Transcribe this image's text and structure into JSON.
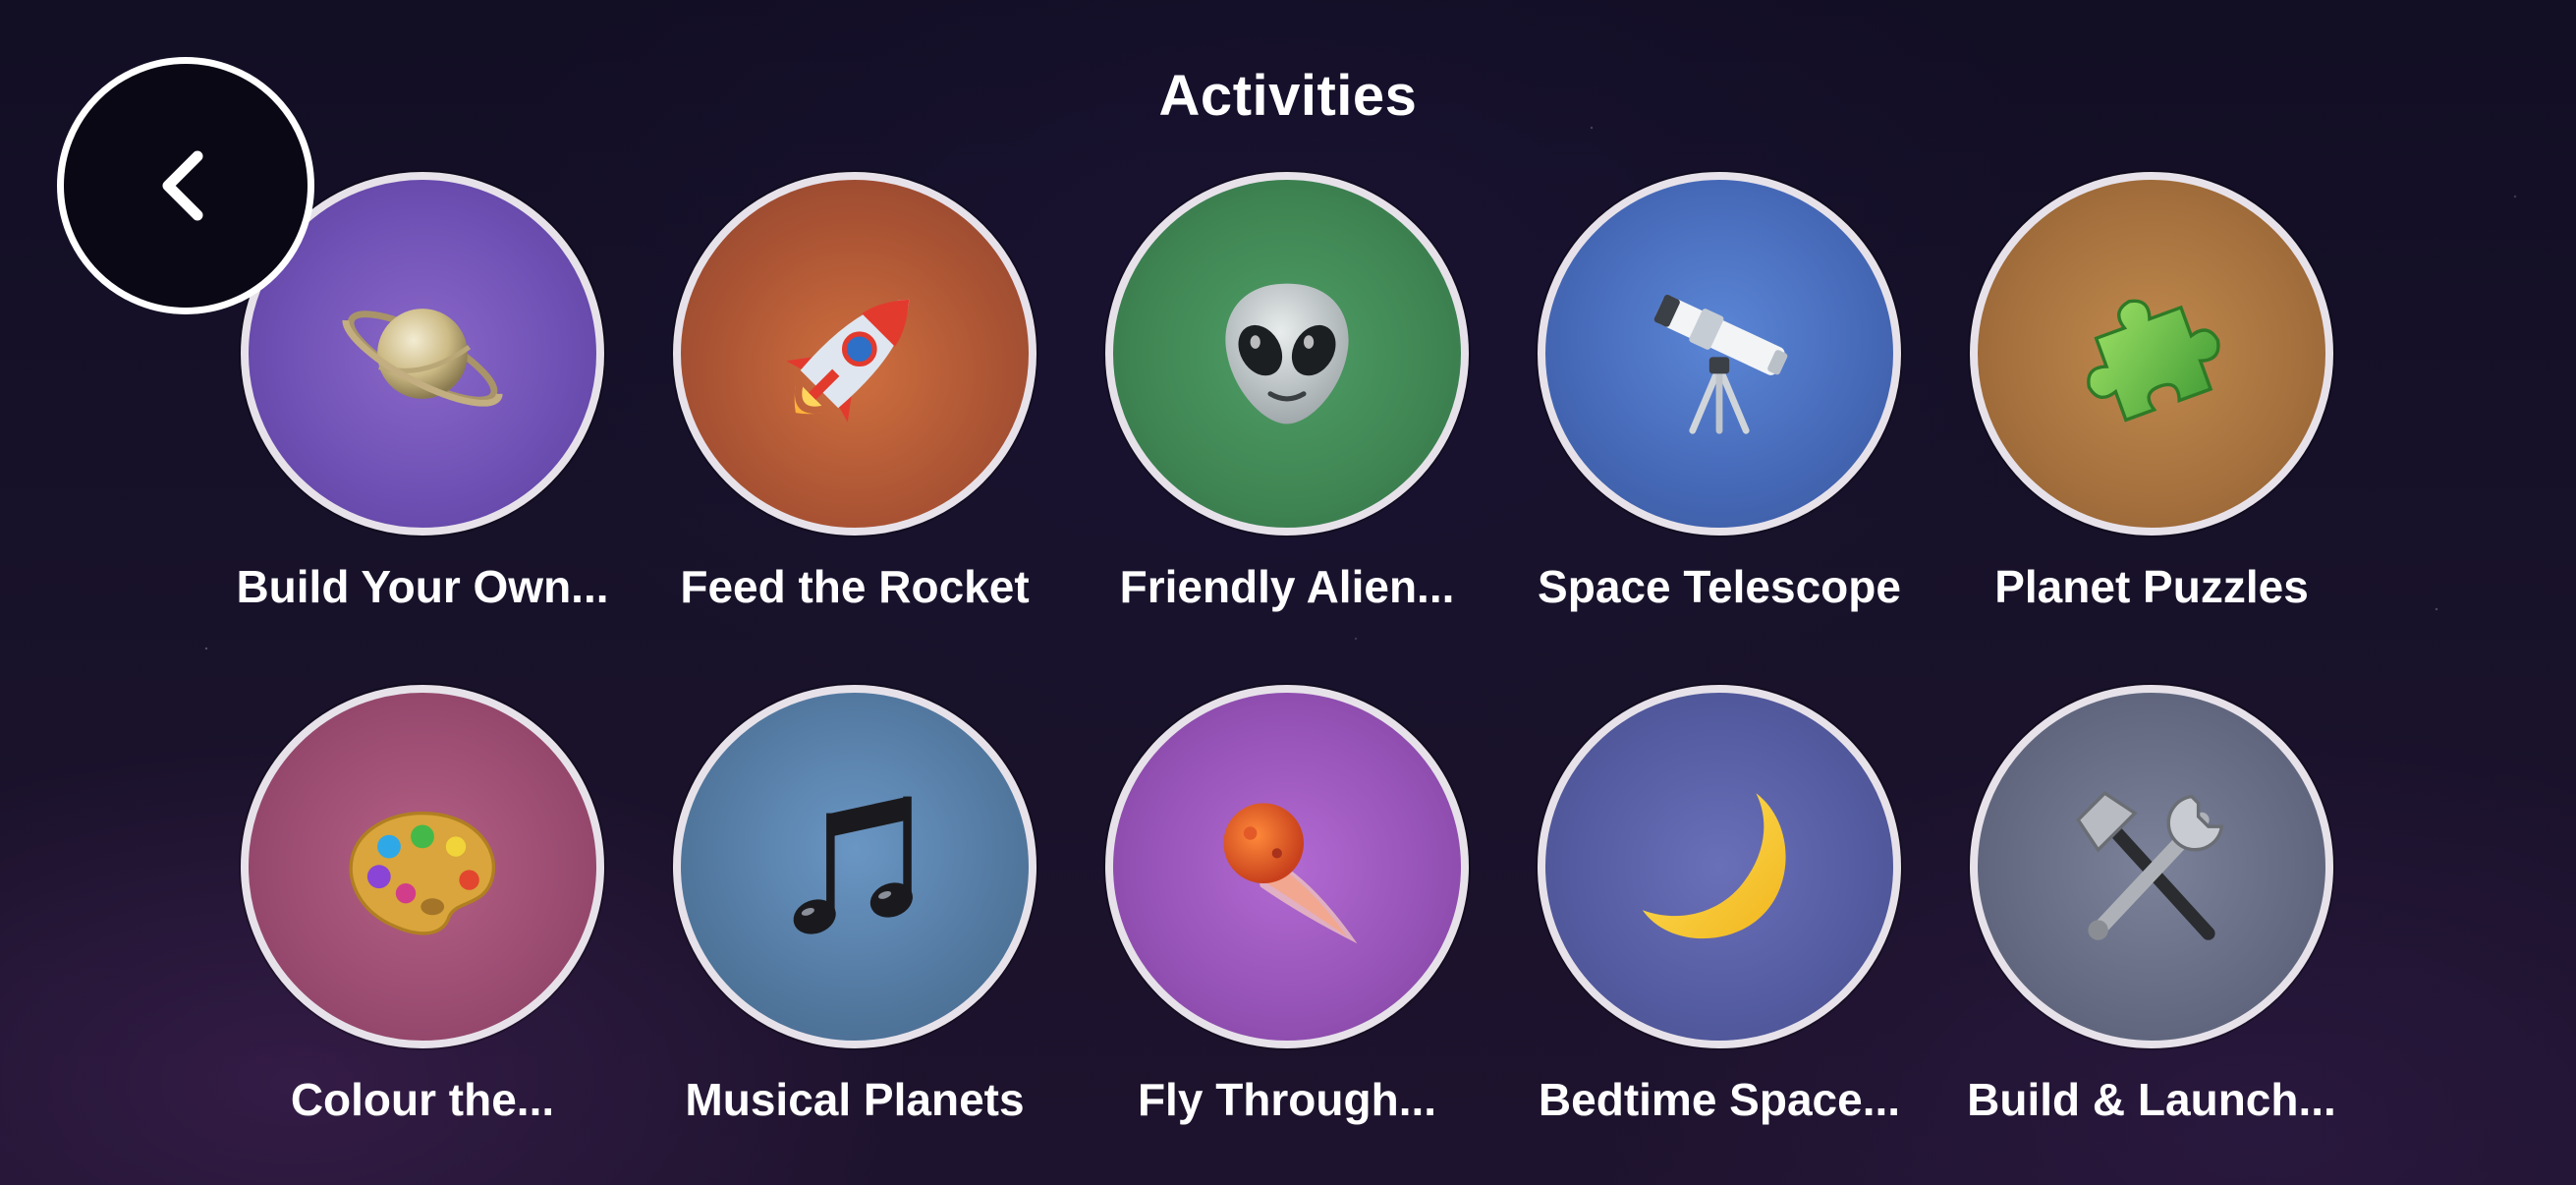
{
  "header": {
    "title": "Activities"
  },
  "colors": {
    "circle_border": "#e7e2ea",
    "background": "#171129",
    "text": "#ffffff"
  },
  "activities": [
    {
      "label": "Build Your Own...",
      "icon": "ringed-planet-icon",
      "color": "#6d4fb3"
    },
    {
      "label": "Feed the Rocket",
      "icon": "rocket-icon",
      "color": "#a85233"
    },
    {
      "label": "Friendly Alien...",
      "icon": "alien-icon",
      "color": "#3f8553"
    },
    {
      "label": "Space Telescope",
      "icon": "telescope-icon",
      "color": "#4568b6"
    },
    {
      "label": "Planet Puzzles",
      "icon": "puzzle-piece-icon",
      "color": "#a5703d"
    },
    {
      "label": "Colour the...",
      "icon": "art-palette-icon",
      "color": "#9a4b70"
    },
    {
      "label": "Musical Planets",
      "icon": "music-notes-icon",
      "color": "#52789f"
    },
    {
      "label": "Fly Through...",
      "icon": "comet-icon",
      "color": "#9552b6"
    },
    {
      "label": "Bedtime Space...",
      "icon": "crescent-moon-icon",
      "color": "#545ba0"
    },
    {
      "label": "Build & Launch...",
      "icon": "hammer-wrench-icon",
      "color": "#646a82"
    }
  ]
}
